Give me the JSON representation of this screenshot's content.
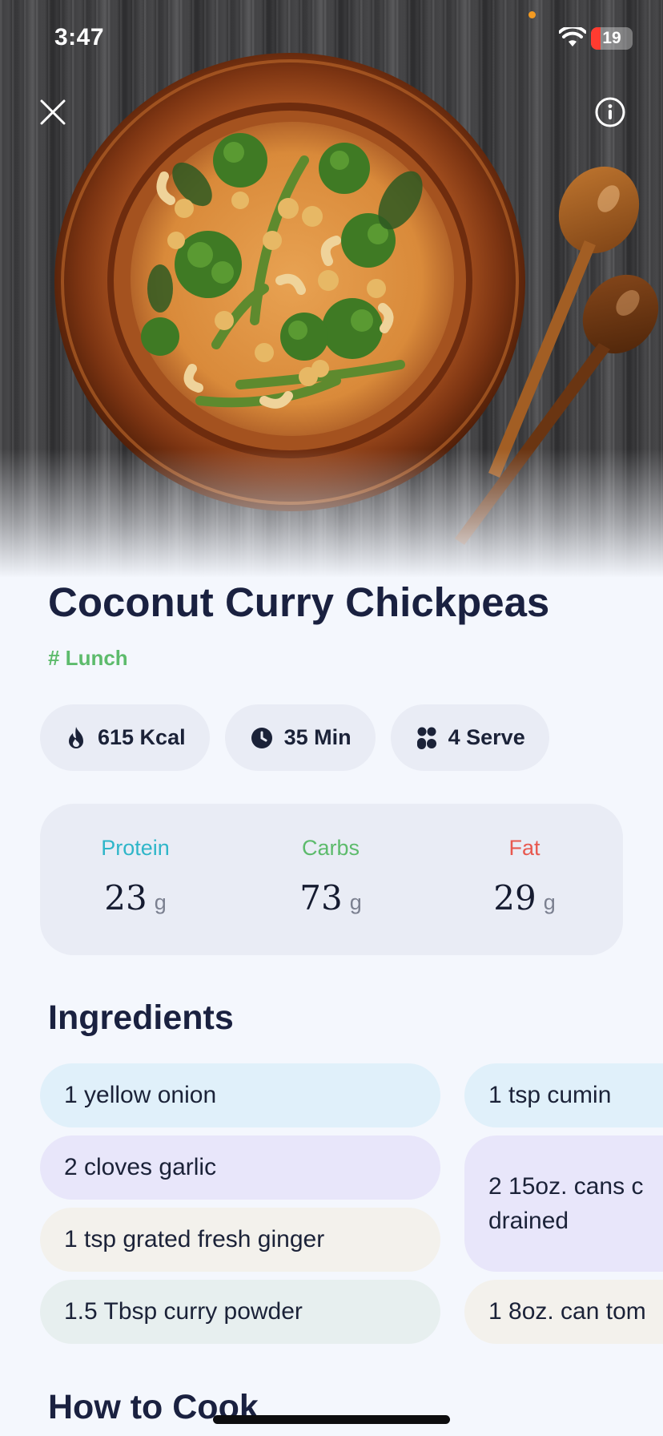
{
  "status_bar": {
    "time": "3:47",
    "battery": "19"
  },
  "hero": {
    "close_icon": "close-icon",
    "info_icon": "info-icon"
  },
  "recipe": {
    "title": "Coconut Curry Chickpeas",
    "tag": "# Lunch",
    "stats": [
      {
        "icon": "flame-icon",
        "label": "615 Kcal"
      },
      {
        "icon": "clock-icon",
        "label": "35 Min"
      },
      {
        "icon": "servings-icon",
        "label": "4 Serve"
      }
    ],
    "macros": [
      {
        "label": "Protein",
        "value": "23",
        "unit": "g",
        "color": "#2fb6c9"
      },
      {
        "label": "Carbs",
        "value": "73",
        "unit": "g",
        "color": "#5dbb6c"
      },
      {
        "label": "Fat",
        "value": "29",
        "unit": "g",
        "color": "#e8584f"
      }
    ]
  },
  "ingredients": {
    "title": "Ingredients",
    "items": [
      {
        "text": "1 yellow onion",
        "color": "#e0f0fa"
      },
      {
        "text": "2 cloves garlic",
        "color": "#e8e6fa"
      },
      {
        "text": "1 tsp grated fresh ginger",
        "color": "#f3f1ec"
      },
      {
        "text": "1.5 Tbsp curry powder",
        "color": "#e7efef"
      },
      {
        "text": "1 tsp cumin",
        "color": "#e0f0fa"
      },
      {
        "text": "2 15oz. cans c drained",
        "color": "#e8e6fa"
      },
      {
        "text": "1 8oz. can tom",
        "color": "#f3f1ec"
      }
    ]
  },
  "how_to_cook": {
    "title": "How to Cook"
  }
}
